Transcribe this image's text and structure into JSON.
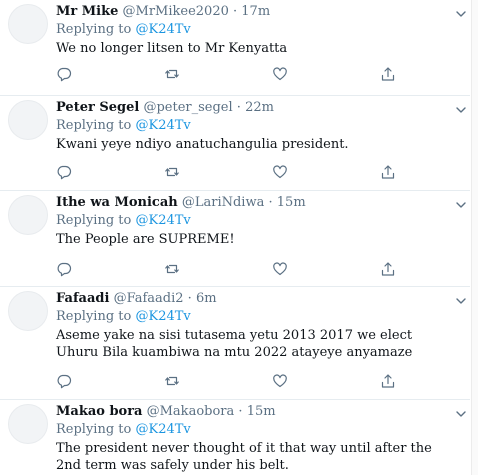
{
  "colors": {
    "text": "#0f1419",
    "secondary": "#5b7083",
    "link": "#1b95e0",
    "divider": "#e6ecf0"
  },
  "tweets": [
    {
      "name": "Mr Mike",
      "handle": "@MrMikee2020",
      "dot": "·",
      "time": "17m",
      "replying_prefix": "Replying to",
      "replying_to": "@K24Tv",
      "text": "We no longer litsen to Mr Kenyatta"
    },
    {
      "name": "Peter Segel",
      "handle": "@peter_segel",
      "dot": "·",
      "time": "22m",
      "replying_prefix": "Replying to",
      "replying_to": "@K24Tv",
      "text": "Kwani yeye ndiyo anatuchangulia president."
    },
    {
      "name": "Ithe wa Monicah",
      "handle": "@LariNdiwa",
      "dot": "·",
      "time": "15m",
      "replying_prefix": "Replying to",
      "replying_to": "@K24Tv",
      "text": "The People are SUPREME!"
    },
    {
      "name": "Fafaadi",
      "handle": "@Fafaadi2",
      "dot": "·",
      "time": "6m",
      "replying_prefix": "Replying to",
      "replying_to": "@K24Tv",
      "text": "Aseme yake na sisi tutasema yetu 2013 2017 we elect Uhuru Bila kuambiwa na mtu 2022 atayeye anyamaze"
    },
    {
      "name": "Makao bora",
      "handle": "@Makaobora",
      "dot": "·",
      "time": "15m",
      "replying_prefix": "Replying to",
      "replying_to": "@K24Tv",
      "text": "The president never thought of it that way until after the 2nd term was safely under his belt."
    }
  ],
  "icons": [
    "reply-icon",
    "retweet-icon",
    "like-icon",
    "share-icon",
    "more-caret-icon"
  ]
}
